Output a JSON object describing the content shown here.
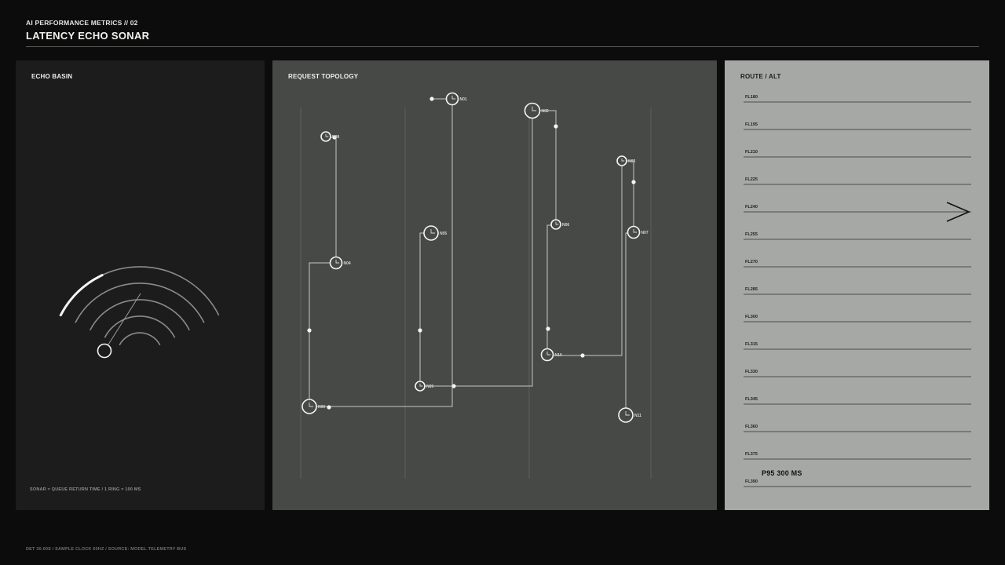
{
  "header": {
    "kicker": "AI PERFORMANCE METRICS // 02",
    "title": "LATENCY ECHO SONAR"
  },
  "echo_panel": {
    "title": "ECHO BASIN",
    "caption": "SONAR = QUEUE RETURN TIME / 1 RING = 100 MS",
    "ring_count": 5,
    "highlighted_ring": 5
  },
  "topology_panel": {
    "title": "REQUEST TOPOLOGY",
    "nodes": [
      {
        "id": "N00",
        "label": "N00"
      },
      {
        "id": "N01",
        "label": "N01"
      },
      {
        "id": "N02",
        "label": "N02"
      },
      {
        "id": "N03",
        "label": "N03"
      },
      {
        "id": "N04",
        "label": "N04"
      },
      {
        "id": "N05",
        "label": "N05"
      },
      {
        "id": "N06",
        "label": "N06"
      },
      {
        "id": "N07",
        "label": "N07"
      },
      {
        "id": "N08",
        "label": "N08"
      },
      {
        "id": "N09",
        "label": "N09"
      },
      {
        "id": "N10",
        "label": "N10"
      },
      {
        "id": "N11",
        "label": "N11"
      }
    ]
  },
  "route_panel": {
    "title": "ROUTE / ALT",
    "levels": [
      "FL180",
      "FL195",
      "FL210",
      "FL225",
      "FL240",
      "FL255",
      "FL270",
      "FL285",
      "FL300",
      "FL315",
      "FL330",
      "FL345",
      "FL360",
      "FL375",
      "FL390"
    ],
    "current_level": "FL240",
    "p95_label": "P95 300 MS"
  },
  "footer": {
    "text": "DET 30.00S  /  SAMPLE CLOCK 60HZ  /  SOURCE: MODEL TELEMETRY BUS"
  },
  "colors": {
    "background": "#0b0c0b",
    "echo_panel": "#1b1c1b",
    "topology_panel": "#474947",
    "route_panel": "#a6a8a5",
    "stroke_light": "#f2f2f0",
    "stroke_dim": "#8a8c89"
  }
}
